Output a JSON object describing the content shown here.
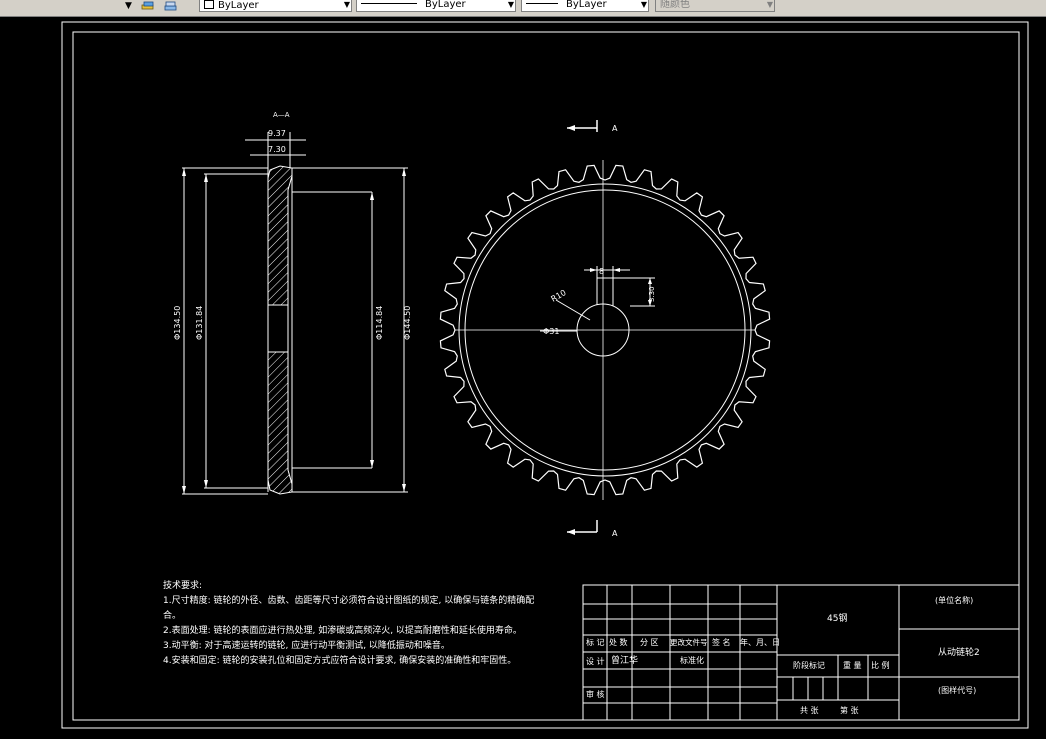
{
  "toolbar": {
    "layer_value": "ByLayer",
    "linetype_value": "ByLayer",
    "lineweight_value": "ByLayer",
    "plotstyle_value": "随颜色"
  },
  "drawing": {
    "section_title": "A—A",
    "dim_9_37": "9.37",
    "dim_7_30": "7.30",
    "dim_d1": "Φ134.50",
    "dim_d2": "Φ131.84",
    "dim_d3": "Φ114.84",
    "dim_d4": "Φ144.50",
    "dim_key_width": "8",
    "dim_key_depth": "3.30",
    "dim_r": "R10",
    "dim_bore": "Φ31",
    "section_mark_top": "A",
    "section_mark_bottom": "A"
  },
  "notes": {
    "title": "技术要求:",
    "lines": [
      "1.尺寸精度: 链轮的外径、齿数、齿距等尺寸必须符合设计图纸的规定, 以确保与链条的精确配",
      "合。",
      "2.表面处理: 链轮的表面应进行热处理, 如渗碳或高频淬火, 以提高耐磨性和延长使用寿命。",
      "3.动平衡: 对于高速运转的链轮, 应进行动平衡测试, 以降低振动和噪音。",
      "4.安装和固定: 链轮的安装孔位和固定方式应符合设计要求, 确保安装的准确性和牢固性。"
    ]
  },
  "title_block": {
    "material": "45钢",
    "company": "(单位名称)",
    "part_name": "从动链轮2",
    "drawing_no": "(图样代号)",
    "row_marks": [
      "标 记",
      "处 数",
      "分 区",
      "更改文件号",
      "签 名",
      "年、月、日"
    ],
    "design_label": "设 计",
    "designer": "曾江华",
    "standardize": "标准化",
    "review": "审 核",
    "stage_mark": "阶段标记",
    "weight": "重 量",
    "scale": "比 例",
    "sheets_total": "共   张",
    "sheet_no": "第   张"
  }
}
